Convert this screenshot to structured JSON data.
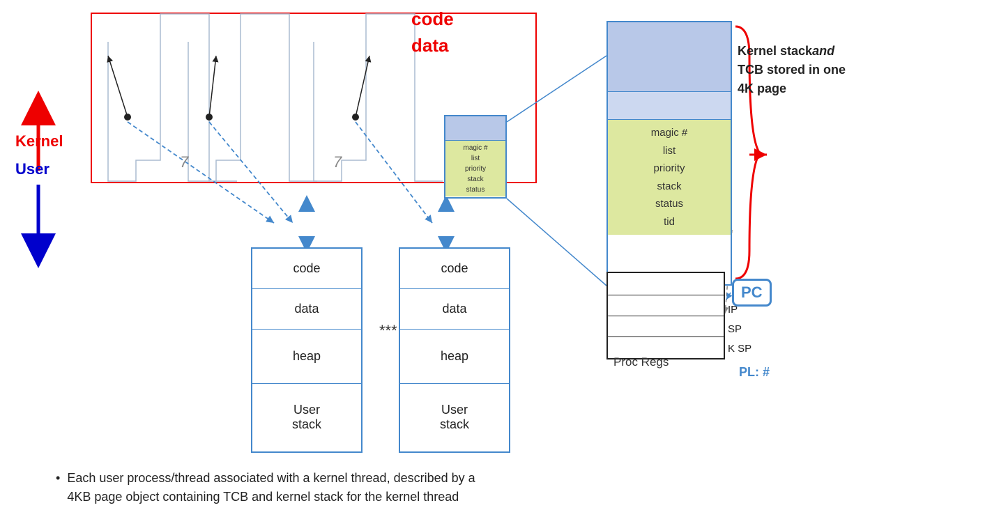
{
  "labels": {
    "code_top": "code",
    "data_top": "data",
    "kernel": "Kernel",
    "user": "User",
    "stars": "***",
    "proc_regs": "Proc Regs",
    "pc": "PC",
    "pl": "PL: #",
    "ip": "IP",
    "sp": "SP",
    "ksp": "K SP"
  },
  "kernel_stack_zoom": {
    "tcb_lines": [
      "magic #",
      "list",
      "priority",
      "stack",
      "status",
      "tid"
    ]
  },
  "thread_detail": {
    "tcb_lines": [
      "magic #",
      "list",
      "priority",
      "stack",
      "status"
    ]
  },
  "brace_label": {
    "line1": "Kernel stack",
    "line2_bold": "and",
    "line3": "TCB stored in one",
    "line4": "4K page"
  },
  "mem_box1": {
    "sections": [
      "code",
      "data",
      "heap",
      "User\nstack"
    ]
  },
  "mem_box2": {
    "sections": [
      "code",
      "data",
      "heap",
      "User\nstack"
    ]
  },
  "bullet": {
    "line1": "Each user process/thread associated with a kernel thread, described by a",
    "line2": "4KB page object containing TCB and kernel stack for the kernel thread"
  }
}
